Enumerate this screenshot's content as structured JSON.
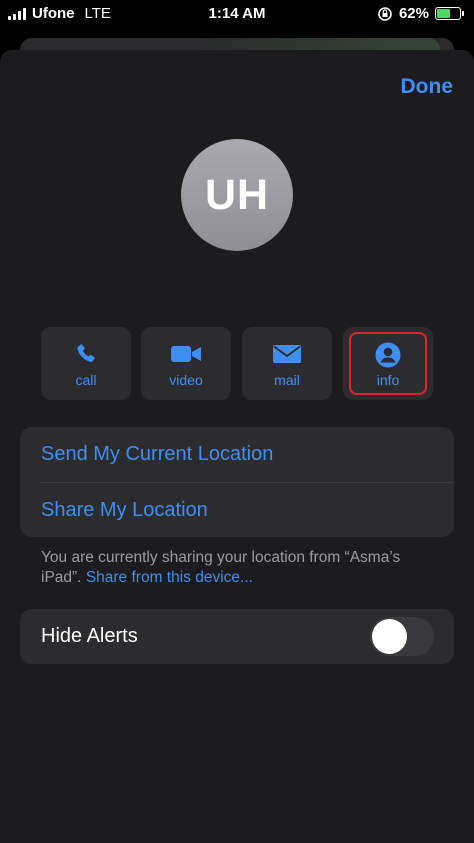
{
  "status": {
    "carrier": "Ufone",
    "network": "LTE",
    "time": "1:14 AM",
    "battery": "62%",
    "battery_level": 0.62,
    "icons": [
      "signal-icon",
      "rotation-lock-icon",
      "battery-charging-icon"
    ]
  },
  "header": {
    "done_label": "Done"
  },
  "contact": {
    "initials": "UH"
  },
  "actions": [
    {
      "label": "call",
      "icon": "phone-icon"
    },
    {
      "label": "video",
      "icon": "video-camera-icon"
    },
    {
      "label": "mail",
      "icon": "envelope-icon"
    },
    {
      "label": "info",
      "icon": "person-icon",
      "highlighted": true
    }
  ],
  "location": {
    "send_current": "Send My Current Location",
    "share": "Share My Location",
    "footnote_text": "You are currently sharing your location from “Asma’s iPad”.",
    "footnote_link": "Share from this device..."
  },
  "alerts": {
    "label": "Hide Alerts",
    "enabled": false
  },
  "colors": {
    "accent": "#3f8ef5",
    "highlight": "#e0262c",
    "sheet": "#1c1c1e",
    "cell": "#2c2c2e"
  }
}
